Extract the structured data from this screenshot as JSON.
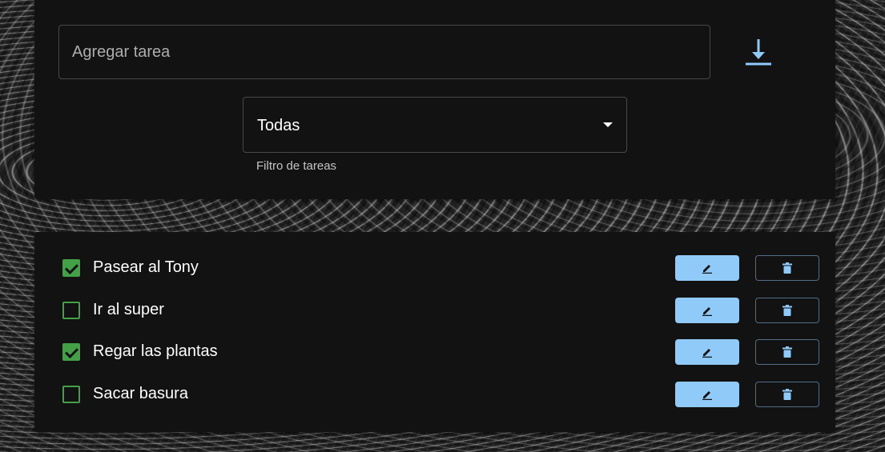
{
  "colors": {
    "card_background": "#121212",
    "accent_blue": "#90caf9",
    "checkbox_green": "#43a047",
    "text": "#ffffff"
  },
  "task_input": {
    "value": "",
    "placeholder": "Agregar tarea"
  },
  "download_button": {
    "icon": "download-icon"
  },
  "filter": {
    "selected": "Todas",
    "helper_text": "Filtro de tareas",
    "icon": "caret-down-icon"
  },
  "tasks": [
    {
      "label": "Pasear al Tony",
      "completed": true
    },
    {
      "label": "Ir al super",
      "completed": false
    },
    {
      "label": "Regar las plantas",
      "completed": true
    },
    {
      "label": "Sacar basura",
      "completed": false
    }
  ],
  "row_actions": {
    "edit_icon": "pencil-icon",
    "delete_icon": "trash-icon"
  }
}
